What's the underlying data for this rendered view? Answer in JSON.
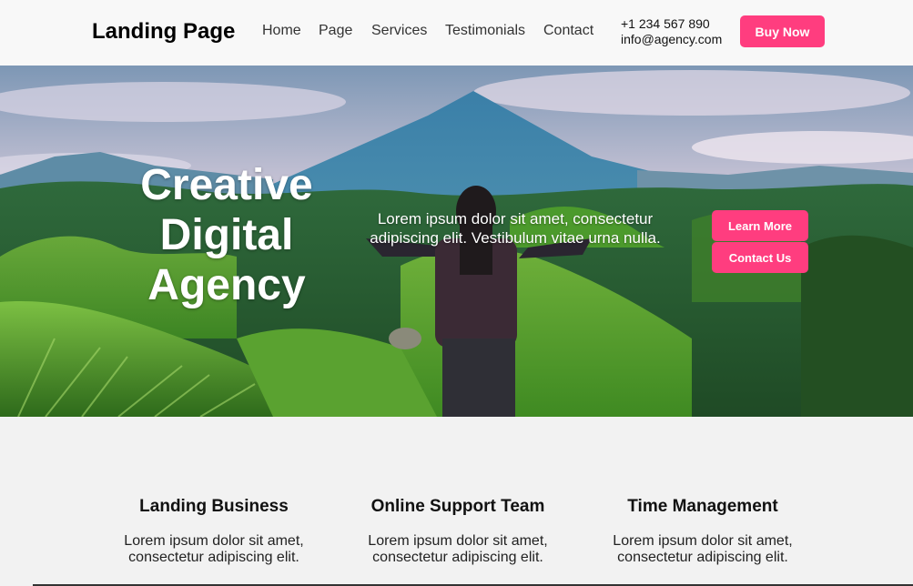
{
  "header": {
    "logo": "Landing Page",
    "nav": [
      "Home",
      "Page",
      "Services",
      "Testimonials",
      "Contact"
    ],
    "phone": "+1 234 567 890",
    "email": "info@agency.com",
    "buy_label": "Buy Now"
  },
  "hero": {
    "title_lines": [
      "Creative",
      "Digital",
      "Agency"
    ],
    "text": "Lorem ipsum dolor sit amet, consectetur adipiscing elit. Vestibulum vitae urna nulla.",
    "learn_more": "Learn More",
    "contact_us": "Contact Us",
    "image": "mountain-landscape-photo"
  },
  "features": [
    {
      "title": "Landing Business",
      "text": "Lorem ipsum dolor sit amet, consectetur adipiscing elit."
    },
    {
      "title": "Online Support Team",
      "text": "Lorem ipsum dolor sit amet, consectetur adipiscing elit."
    },
    {
      "title": "Time Management",
      "text": "Lorem ipsum dolor sit amet, consectetur adipiscing elit."
    }
  ],
  "colors": {
    "accent": "#ff3d7f",
    "header_bg": "#f8f8f8",
    "section_bg": "#f2f2f2"
  }
}
